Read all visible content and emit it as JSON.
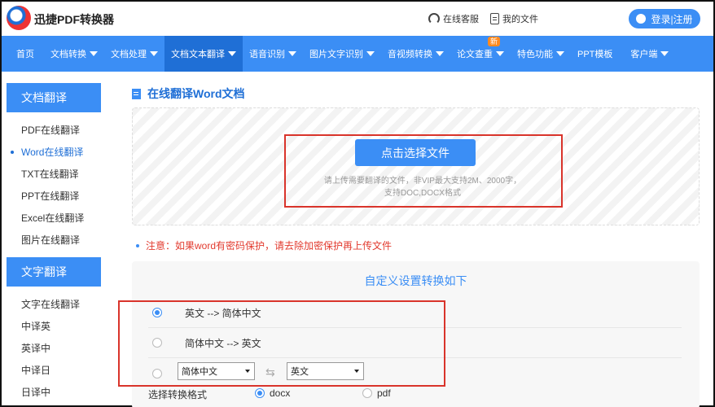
{
  "header": {
    "brand": "迅捷PDF转换器",
    "service": "在线客服",
    "my_files": "我的文件",
    "login": "登录|注册"
  },
  "nav": {
    "items": [
      "首页",
      "文档转换",
      "文档处理",
      "文档文本翻译",
      "语音识别",
      "图片文字识别",
      "音视频转换",
      "论文查重",
      "特色功能",
      "PPT模板",
      "客户端"
    ],
    "active": "文档文本翻译",
    "badge_new": "新"
  },
  "sidebar": {
    "doc_head": "文档翻译",
    "doc_items": [
      "PDF在线翻译",
      "Word在线翻译",
      "TXT在线翻译",
      "PPT在线翻译",
      "Excel在线翻译",
      "图片在线翻译"
    ],
    "active_item": "Word在线翻译",
    "text_head": "文字翻译",
    "text_items": [
      "文字在线翻译",
      "中译英",
      "英译中",
      "中译日",
      "日译中"
    ]
  },
  "main": {
    "title": "在线翻译Word文档",
    "choose_button": "点击选择文件",
    "hint_line1": "请上传需要翻译的文件，非VIP最大支持2M、2000字，",
    "hint_line2": "支持DOC,DOCX格式",
    "warning": "注意：如果word有密码保护，请去除加密保护再上传文件",
    "settings_title": "自定义设置转换如下",
    "option1": "英文 --> 简体中文",
    "option2": "简体中文 --> 英文",
    "from_lang": "简体中文",
    "to_lang": "英文",
    "format_label": "选择转换格式",
    "format_docx": "docx",
    "format_pdf": "pdf"
  },
  "colors": {
    "primary": "#3b8ef5",
    "nav_active": "#1f6fd6",
    "warning": "#e23a2e",
    "highlight_box": "#d9342b"
  }
}
